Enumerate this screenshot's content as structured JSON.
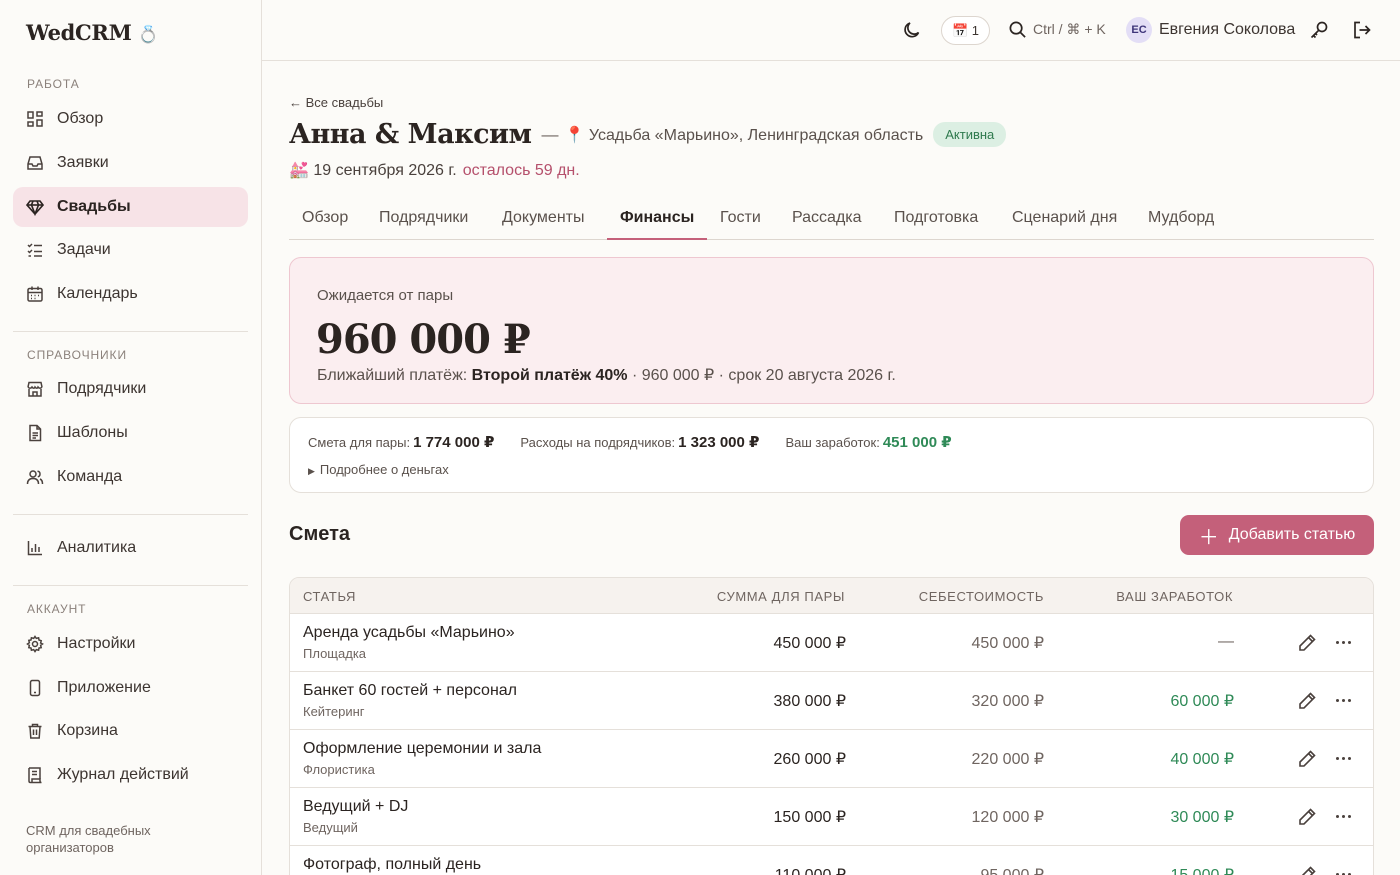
{
  "app": {
    "logo": "WedCRM",
    "logo_icon": "💍"
  },
  "sidebar": {
    "sections": [
      {
        "label": "Работа",
        "items": [
          {
            "label": "Обзор",
            "icon": "dashboard-icon"
          },
          {
            "label": "Заявки",
            "icon": "inbox-icon"
          },
          {
            "label": "Свадьбы",
            "icon": "diamond-icon",
            "active": true
          },
          {
            "label": "Задачи",
            "icon": "tasks-icon"
          },
          {
            "label": "Календарь",
            "icon": "calendar-icon"
          }
        ]
      },
      {
        "label": "Справочники",
        "items": [
          {
            "label": "Подрядчики",
            "icon": "store-icon"
          },
          {
            "label": "Шаблоны",
            "icon": "document-icon"
          },
          {
            "label": "Команда",
            "icon": "team-icon"
          }
        ]
      },
      {
        "label": "",
        "items": [
          {
            "label": "Аналитика",
            "icon": "bar-chart-icon"
          }
        ]
      },
      {
        "label": "Аккаунт",
        "items": [
          {
            "label": "Настройки",
            "icon": "gear-icon"
          },
          {
            "label": "Приложение",
            "icon": "phone-icon"
          },
          {
            "label": "Корзина",
            "icon": "trash-icon"
          },
          {
            "label": "Журнал действий",
            "icon": "log-icon"
          }
        ]
      }
    ],
    "footer": "CRM для свадебных организаторов"
  },
  "topbar": {
    "calendar_badge": "📅 1",
    "search_hint": "Ctrl / ⌘ + K",
    "user_initials": "ЕС",
    "user_name": "Евгения Соколова"
  },
  "wedding": {
    "back_link": "← Все свадьбы",
    "title": "Анна & Максим",
    "dash": "—",
    "venue": "📍 Усадьба «Марьино», Ленинградская область",
    "status": "Активна",
    "date": "💒 19 сентября 2026 г.",
    "remaining": "осталось 59 дн."
  },
  "tabs": [
    {
      "label": "Обзор"
    },
    {
      "label": "Подрядчики"
    },
    {
      "label": "Документы"
    },
    {
      "label": "Финансы",
      "active": true
    },
    {
      "label": "Гости"
    },
    {
      "label": "Рассадка"
    },
    {
      "label": "Подготовка"
    },
    {
      "label": "Сценарий дня"
    },
    {
      "label": "Мудборд"
    }
  ],
  "expected": {
    "label": "Ожидается от пары",
    "amount": "960 000 ₽",
    "next_prefix": "Ближайший платёж:",
    "next_name": "Второй платёж 40%",
    "next_rest": "· 960 000 ₽ · срок 20 августа 2026 г."
  },
  "summary": {
    "budget_label": "Смета для пары:",
    "budget_value": "1 774 000 ₽",
    "expenses_label": "Расходы на подрядчиков:",
    "expenses_value": "1 323 000 ₽",
    "earnings_label": "Ваш заработок:",
    "earnings_value": "451 000 ₽",
    "details": "Подробнее о деньгах"
  },
  "estimate": {
    "title": "Смета",
    "add_button": "Добавить статью",
    "columns": {
      "item": "Статья",
      "price": "Сумма для пары",
      "cost": "Себестоимость",
      "earn": "Ваш заработок"
    },
    "rows": [
      {
        "name": "Аренда усадьбы «Марьино»",
        "category": "Площадка",
        "price": "450 000 ₽",
        "cost": "450 000 ₽",
        "earn": "—"
      },
      {
        "name": "Банкет 60 гостей + персонал",
        "category": "Кейтеринг",
        "price": "380 000 ₽",
        "cost": "320 000 ₽",
        "earn": "60 000 ₽"
      },
      {
        "name": "Оформление церемонии и зала",
        "category": "Флористика",
        "price": "260 000 ₽",
        "cost": "220 000 ₽",
        "earn": "40 000 ₽"
      },
      {
        "name": "Ведущий + DJ",
        "category": "Ведущий",
        "price": "150 000 ₽",
        "cost": "120 000 ₽",
        "earn": "30 000 ₽"
      },
      {
        "name": "Фотограф, полный день",
        "category": "",
        "price": "110 000 ₽",
        "cost": "95 000 ₽",
        "earn": "15 000 ₽"
      }
    ]
  },
  "colors": {
    "accent": "#c4607a",
    "active_nav_bg": "#f7e3e7",
    "success": "#2f8a57"
  }
}
